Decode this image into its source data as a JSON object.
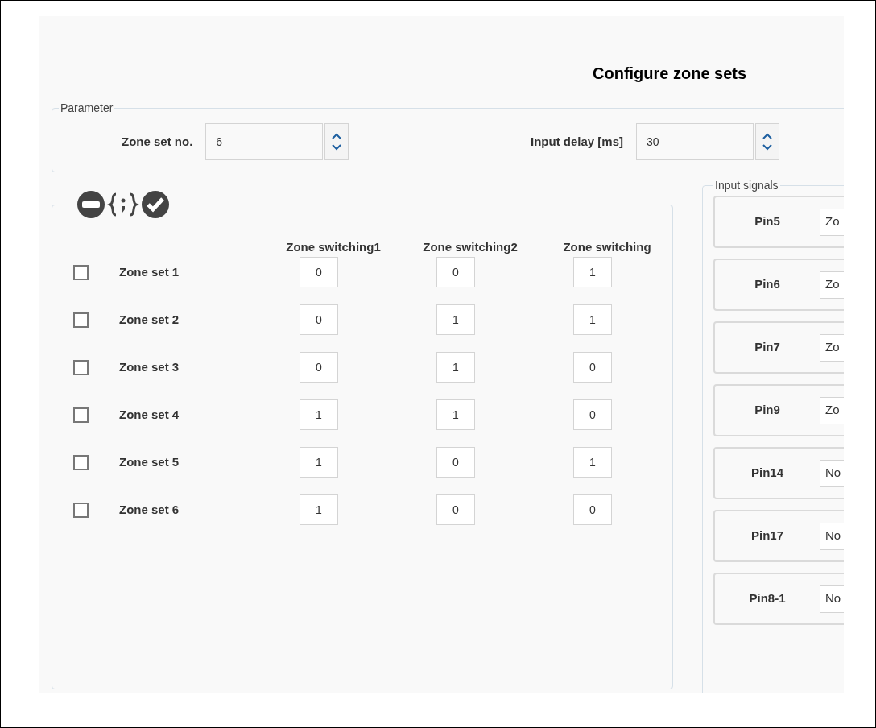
{
  "title": "Configure zone sets",
  "parameter": {
    "legend": "Parameter",
    "fields": [
      {
        "label": "Zone set no.",
        "value": "6"
      },
      {
        "label": "Input delay [ms]",
        "value": "30"
      }
    ]
  },
  "zone_table": {
    "columns": [
      "Zone switching1",
      "Zone switching2",
      "Zone switching"
    ],
    "rows": [
      {
        "checked": false,
        "name": "Zone set 1",
        "values": [
          "0",
          "0",
          "1"
        ]
      },
      {
        "checked": false,
        "name": "Zone set 2",
        "values": [
          "0",
          "1",
          "1"
        ]
      },
      {
        "checked": false,
        "name": "Zone set 3",
        "values": [
          "0",
          "1",
          "0"
        ]
      },
      {
        "checked": false,
        "name": "Zone set 4",
        "values": [
          "1",
          "1",
          "0"
        ]
      },
      {
        "checked": false,
        "name": "Zone set 5",
        "values": [
          "1",
          "0",
          "1"
        ]
      },
      {
        "checked": false,
        "name": "Zone set 6",
        "values": [
          "1",
          "0",
          "0"
        ]
      }
    ]
  },
  "input_signals": {
    "legend": "Input signals",
    "pins": [
      {
        "label": "Pin5",
        "value": "Zo"
      },
      {
        "label": "Pin6",
        "value": "Zo"
      },
      {
        "label": "Pin7",
        "value": "Zo"
      },
      {
        "label": "Pin9",
        "value": "Zo"
      },
      {
        "label": "Pin14",
        "value": "No"
      },
      {
        "label": "Pin17",
        "value": "No"
      },
      {
        "label": "Pin8-1",
        "value": "No"
      }
    ]
  }
}
